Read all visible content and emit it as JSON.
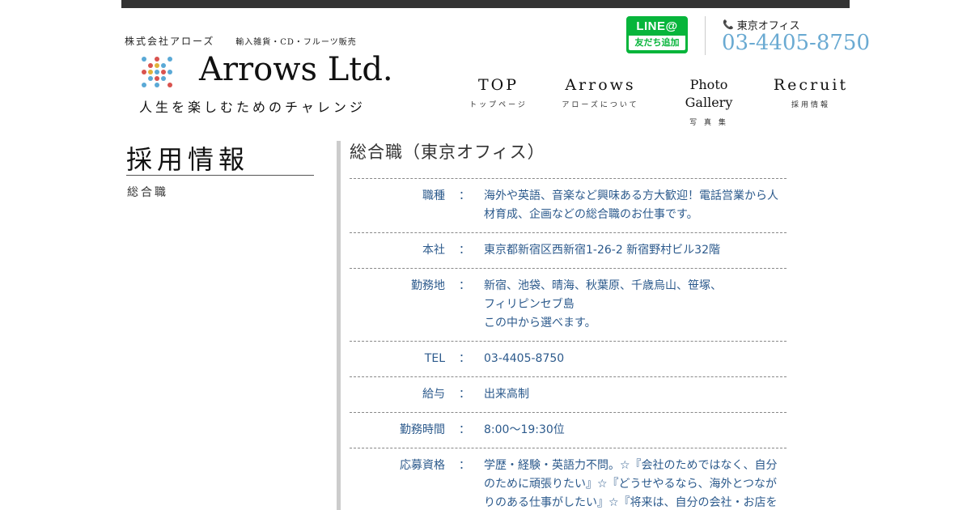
{
  "header": {
    "company": "株式会社アローズ",
    "business": "輸入雑貨・CD・フルーツ販売",
    "brand": "Arrows Ltd.",
    "tagline": "人生を楽しむためのチャレンジ",
    "line_button": {
      "top": "LINE@",
      "bottom": "友だち追加"
    },
    "office_label": "東京オフィス",
    "phone": "03-4405-8750"
  },
  "nav": [
    {
      "label": "TOP",
      "sub": "トップページ"
    },
    {
      "label": "Arrows",
      "sub": "アローズについて"
    },
    {
      "label": "Photo Gallery",
      "sub": "写 真 集"
    },
    {
      "label": "Recruit",
      "sub": "採用情報"
    }
  ],
  "sidebar": {
    "title": "採用情報",
    "items": [
      "総合職"
    ]
  },
  "content": {
    "title": "総合職（東京オフィス）",
    "rows": [
      {
        "key": "職種",
        "lines": [
          "海外や英語、音楽など興味ある方大歓迎！電話営業から人",
          "材育成、企画などの総合職のお仕事です。"
        ]
      },
      {
        "key": "本社",
        "lines": [
          "東京都新宿区西新宿1-26-2 新宿野村ビル32階"
        ]
      },
      {
        "key": "勤務地",
        "lines": [
          "新宿、池袋、晴海、秋葉原、千歳烏山、笹塚、",
          "フィリピンセブ島",
          "この中から選べます。"
        ]
      },
      {
        "key": "TEL",
        "lines": [
          "03-4405-8750"
        ]
      },
      {
        "key": "給与",
        "lines": [
          "出来高制"
        ]
      },
      {
        "key": "勤務時間",
        "lines": [
          "8:00〜19:30位"
        ]
      },
      {
        "key": "応募資格",
        "lines": [
          "学歴・経験・英語力不問。☆『会社のためではなく、自分",
          "のために頑張りたい』☆『どうせやるなら、海外とつなが",
          "りのある仕事がしたい』☆『将来は、自分の会社・お店を"
        ]
      }
    ],
    "separator": "："
  },
  "colors": {
    "accent_blue": "#6aaad2",
    "text_blue": "#2c5a8c",
    "line_green": "#07b53b"
  }
}
